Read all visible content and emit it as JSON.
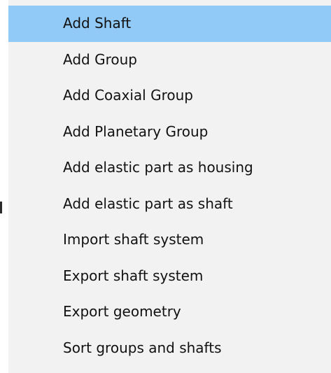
{
  "context_menu": {
    "highlight_color": "#91c9f7",
    "items": [
      {
        "label": "Add Shaft",
        "highlighted": true
      },
      {
        "label": "Add Group"
      },
      {
        "label": "Add Coaxial Group"
      },
      {
        "label": "Add Planetary Group"
      },
      {
        "label": "Add elastic part as housing"
      },
      {
        "label": "Add elastic part as shaft"
      },
      {
        "label": "Import shaft system"
      },
      {
        "label": "Export shaft system"
      },
      {
        "label": "Export geometry"
      },
      {
        "label": "Sort groups and shafts"
      }
    ]
  }
}
